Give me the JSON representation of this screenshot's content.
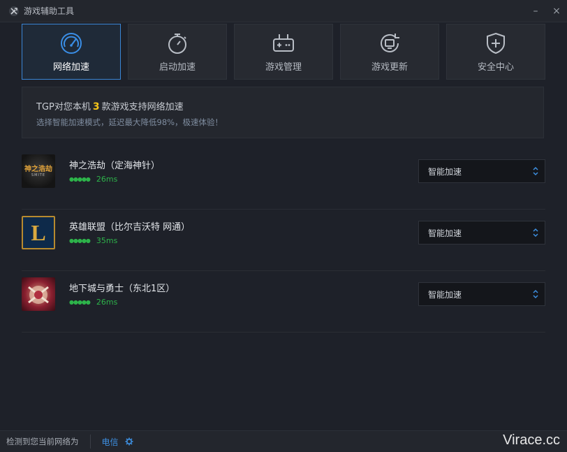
{
  "window": {
    "title": "游戏辅助工具",
    "controls": {
      "minimize": "–",
      "close": "×"
    }
  },
  "tabs": [
    {
      "label": "网络加速",
      "icon": "speedometer-icon",
      "active": true
    },
    {
      "label": "启动加速",
      "icon": "stopwatch-icon",
      "active": false
    },
    {
      "label": "游戏管理",
      "icon": "gamepad-icon",
      "active": false
    },
    {
      "label": "游戏更新",
      "icon": "refresh-monitor-icon",
      "active": false
    },
    {
      "label": "安全中心",
      "icon": "shield-icon",
      "active": false
    }
  ],
  "info": {
    "prefix": "TGP对您本机",
    "count": "3",
    "suffix": "款游戏支持网络加速",
    "subtitle": "选择智能加速模式，延迟最大降低98%，极速体验！"
  },
  "games": [
    {
      "name": "神之浩劫（定海神针）",
      "ping": "26ms",
      "mode": "智能加速",
      "thumb_text": "神之浩劫",
      "thumb_sub": "SMITE"
    },
    {
      "name": "英雄联盟（比尔吉沃特 网通）",
      "ping": "35ms",
      "mode": "智能加速",
      "thumb_text": "L"
    },
    {
      "name": "地下城与勇士（东北1区）",
      "ping": "26ms",
      "mode": "智能加速"
    }
  ],
  "footer": {
    "network_label": "检测到您当前网络为",
    "carrier": "电信",
    "watermark": "Virace.cc"
  },
  "colors": {
    "accent": "#3a86d6",
    "ping_green": "#2db34a",
    "count_yellow": "#f5c518",
    "carrier_blue": "#3d8fe0"
  }
}
